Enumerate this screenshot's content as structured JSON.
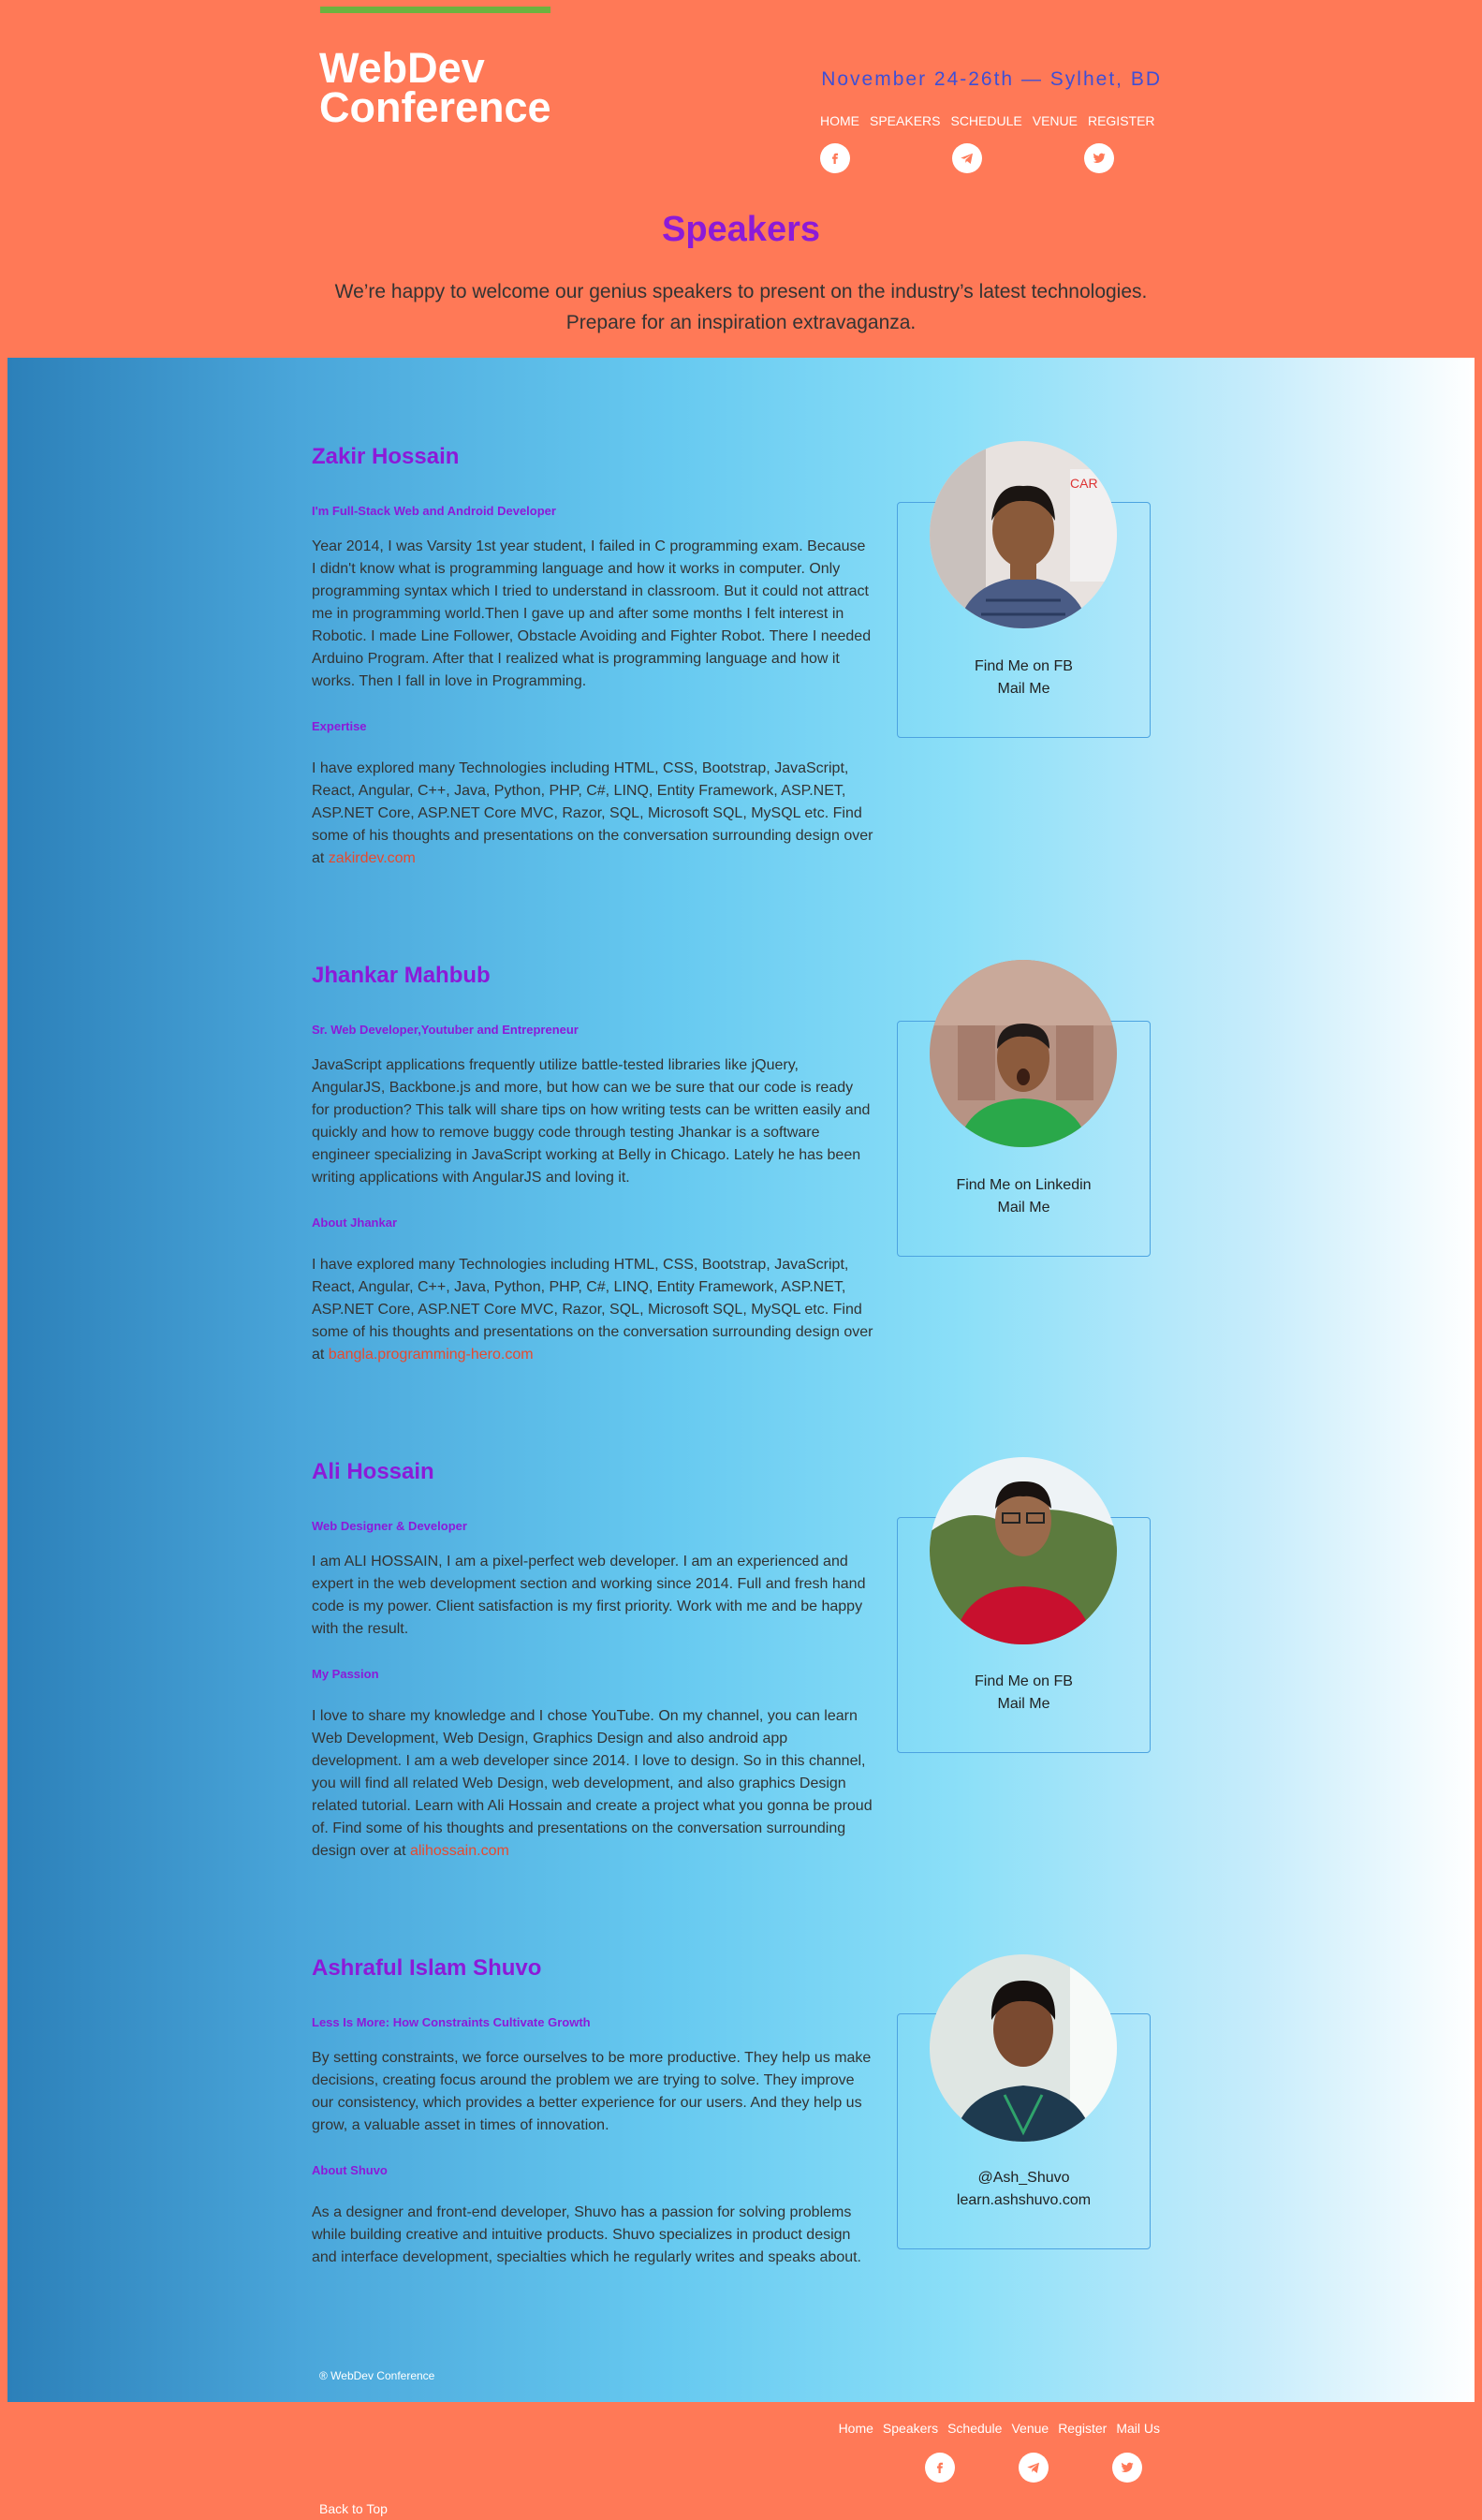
{
  "header": {
    "logo_line1": "WebDev",
    "logo_line2": "Conference",
    "dates": "November 24-26th — Sylhet, BD",
    "nav": [
      "HOME",
      "SPEAKERS",
      "SCHEDULE",
      "VENUE",
      "REGISTER"
    ],
    "social_icons": [
      "facebook-icon",
      "telegram-icon",
      "twitter-icon"
    ],
    "accent_bar_color": "#6cb33f"
  },
  "hero": {
    "title": "Speakers",
    "intro_line1": "We’re happy to welcome our genius speakers to present on the industry’s latest technologies.",
    "intro_line2": "Prepare for an inspiration extravaganza."
  },
  "speakers": [
    {
      "name": "Zakir Hossain",
      "tagline": "I'm Full-Stack Web and Android Developer",
      "bio": "Year 2014, I was Varsity 1st year student, I failed in C programming exam. Because I didn't know what is programming language and how it works in computer. Only programming syntax which I tried to understand in classroom. But it could not attract me in programming world.Then I gave up and after some months I felt interest in Robotic. I made Line Follower, Obstacle Avoiding and Fighter Robot. There I needed Arduino Program. After that I realized what is programming language and how it works. Then I fall in love in Programming.",
      "section_title": "Expertise",
      "section_text": "I have explored many Technologies including HTML, CSS, Bootstrap, JavaScript, React, Angular, C++, Java, Python, PHP, C#, LINQ, Entity Framework, ASP.NET, ASP.NET Core, ASP.NET Core MVC, Razor, SQL, Microsoft SQL, MySQL etc. Find some of his thoughts and presentations on the conversation surrounding design over at",
      "link": "zakirdev.com",
      "card_line1": "Find Me on FB",
      "card_line2": "Mail Me"
    },
    {
      "name": "Jhankar Mahbub",
      "tagline": "Sr. Web Developer,Youtuber and Entrepreneur",
      "bio": "JavaScript applications frequently utilize battle-tested libraries like jQuery, AngularJS, Backbone.js and more, but how can we be sure that our code is ready for production? This talk will share tips on how writing tests can be written easily and quickly and how to remove buggy code through testing Jhankar is a software engineer specializing in JavaScript working at Belly in Chicago. Lately he has been writing applications with AngularJS and loving it.",
      "section_title": "About Jhankar",
      "section_text": "I have explored many Technologies including HTML, CSS, Bootstrap, JavaScript, React, Angular, C++, Java, Python, PHP, C#, LINQ, Entity Framework, ASP.NET, ASP.NET Core, ASP.NET Core MVC, Razor, SQL, Microsoft SQL, MySQL etc. Find some of his thoughts and presentations on the conversation surrounding design over at",
      "link": "bangla.programming-hero.com",
      "card_line1": "Find Me on Linkedin",
      "card_line2": "Mail Me"
    },
    {
      "name": "Ali Hossain",
      "tagline": "Web Designer & Developer",
      "bio": "I am ALI HOSSAIN, I am a pixel-perfect web developer. I am an experienced and expert in the web development section and working since 2014. Full and fresh hand code is my power. Client satisfaction is my first priority. Work with me and be happy with the result.",
      "section_title": "My Passion",
      "section_text": "I love to share my knowledge and I chose YouTube. On my channel, you can learn Web Development, Web Design, Graphics Design and also android app development. I am a web developer since 2014. I love to design. So in this channel, you will find all related Web Design, web development, and also graphics Design related tutorial. Learn with Ali Hossain and create a project what you gonna be proud of. Find some of his thoughts and presentations on the conversation surrounding design over at",
      "link": "alihossain.com",
      "card_line1": "Find Me on FB",
      "card_line2": "Mail Me"
    },
    {
      "name": "Ashraful Islam Shuvo",
      "tagline": "Less Is More: How Constraints Cultivate Growth",
      "bio": "By setting constraints, we force ourselves to be more productive. They help us make decisions, creating focus around the problem we are trying to solve. They improve our consistency, which provides a better experience for our users. And they help us grow, a valuable asset in times of innovation.",
      "section_title": "About Shuvo",
      "section_text": "As a designer and front-end developer, Shuvo has a passion for solving problems while building creative and intuitive products. Shuvo specializes in product design and interface development, specialties which he regularly writes and speaks about.",
      "link": "",
      "card_line1": "@Ash_Shuvo",
      "card_line2": "learn.ashshuvo.com"
    }
  ],
  "footer": {
    "copyright": "® WebDev Conference",
    "nav": [
      "Home",
      "Speakers",
      "Schedule",
      "Venue",
      "Register",
      "Mail Us"
    ],
    "back_to_top": "Back to Top"
  }
}
